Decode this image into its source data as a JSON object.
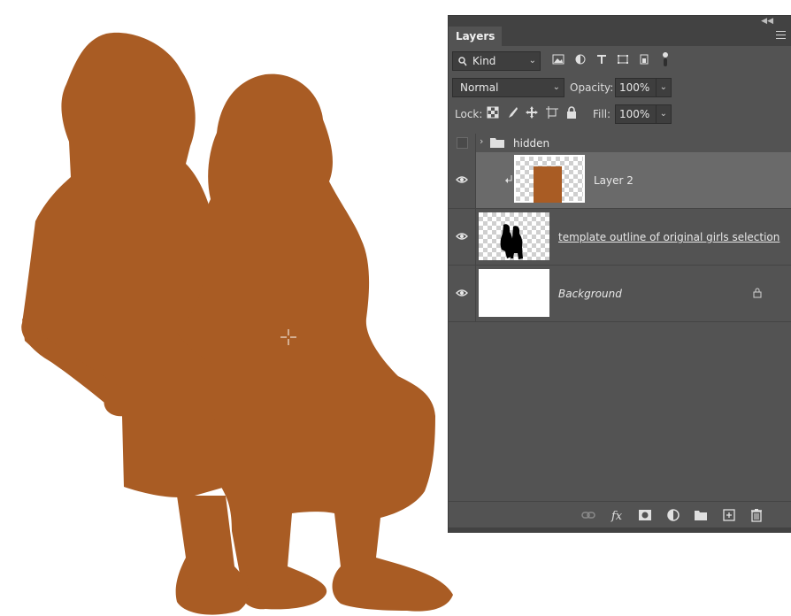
{
  "colors": {
    "silhouette": "#a95c24",
    "panel_bg": "#535353",
    "panel_dark": "#424242",
    "selected_row": "#6a6a6a"
  },
  "panel": {
    "tab_label": "Layers",
    "filter": {
      "kind_label": "Kind"
    },
    "blend_mode": "Normal",
    "opacity_label": "Opacity:",
    "opacity_value": "100%",
    "lock_label": "Lock:",
    "fill_label": "Fill:",
    "fill_value": "100%"
  },
  "layers": [
    {
      "name": "hidden",
      "type": "group",
      "visible": false
    },
    {
      "name": "Layer 2",
      "type": "clipped",
      "visible": true,
      "selected": true
    },
    {
      "name": "template outline of original girls selection",
      "type": "normal",
      "visible": true
    },
    {
      "name": "Background",
      "type": "background",
      "visible": true,
      "locked": true
    }
  ],
  "icons": {
    "filter": [
      "image-filter-icon",
      "adjustment-filter-icon",
      "type-filter-icon",
      "shape-filter-icon",
      "smart-object-filter-icon",
      "toggle-filter-icon"
    ],
    "lock": [
      "lock-transparent-icon",
      "lock-image-icon",
      "lock-position-icon",
      "lock-artboard-icon",
      "lock-all-icon"
    ],
    "bottom": [
      "link-layers-icon",
      "fx-icon",
      "add-mask-icon",
      "adjustment-layer-icon",
      "new-group-icon",
      "new-layer-icon",
      "delete-layer-icon"
    ]
  }
}
